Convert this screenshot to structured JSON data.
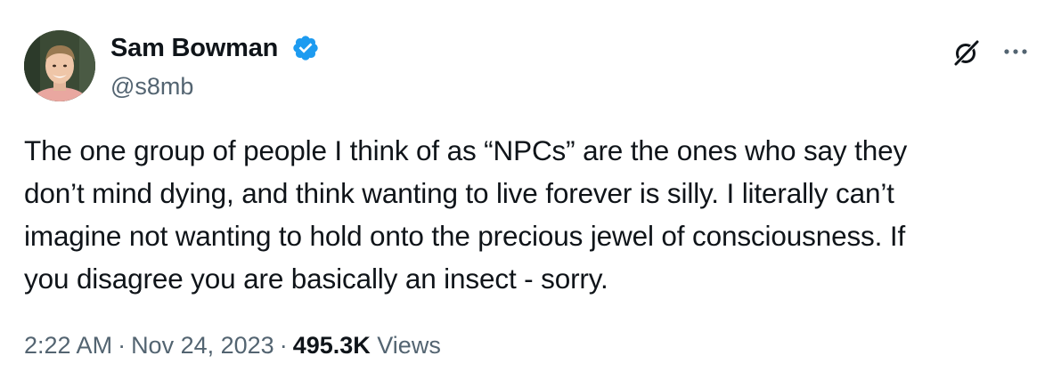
{
  "author": {
    "name": "Sam Bowman",
    "handle": "@s8mb",
    "verified": true,
    "verified_color": "#1d9bf0"
  },
  "tweet": {
    "lines": [
      "The one group of people I think of as “NPCs” are the ones who say they",
      "don’t mind dying, and think wanting to live forever is silly. I literally can’t",
      "imagine not wanting to hold onto the precious jewel of consciousness. If",
      "you disagree you are basically an insect - sorry."
    ]
  },
  "meta": {
    "time": "2:22 AM",
    "separator": "·",
    "date": "Nov 24, 2023",
    "views_count": "495.3K",
    "views_label": "Views"
  },
  "icons": {
    "verified": "verified-badge-icon",
    "grok": "grok-icon",
    "more": "more-icon"
  },
  "colors": {
    "text_primary": "#0f1419",
    "text_secondary": "#536471",
    "accent": "#1d9bf0"
  }
}
